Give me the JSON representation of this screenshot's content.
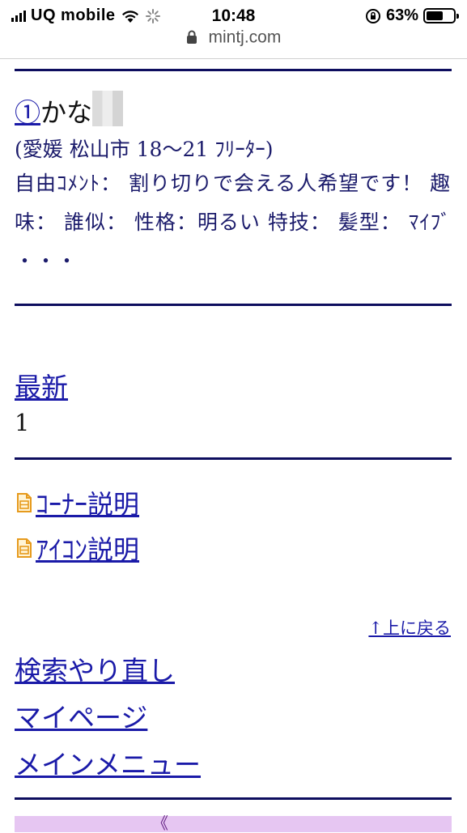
{
  "status_bar": {
    "carrier": "UQ mobile",
    "time": "10:48",
    "battery_percent": "63%",
    "battery_level": 0.63
  },
  "browser": {
    "url": "mintj.com"
  },
  "profile": {
    "number": "①",
    "name": "かな",
    "location": "(愛媛 松山市 18〜21 ﾌﾘｰﾀｰ)",
    "comment": "自由ｺﾒﾝﾄ： 割り切りで会える人希望です！ 趣味： 誰似： 性格：明るい 特技： 髪型： ﾏｲﾌﾞ ・・・"
  },
  "latest": {
    "label": "最新",
    "count": "1"
  },
  "info_links": [
    {
      "label": "ｺｰﾅｰ説明",
      "icon": "document-icon"
    },
    {
      "label": "ｱｲｺﾝ説明",
      "icon": "document-icon"
    }
  ],
  "back_to_top": "↑上に戻る",
  "nav": {
    "search_again": "検索やり直し",
    "my_page": "マイページ",
    "main_menu": "メインメニュー"
  },
  "footer_bar_text": "《"
}
